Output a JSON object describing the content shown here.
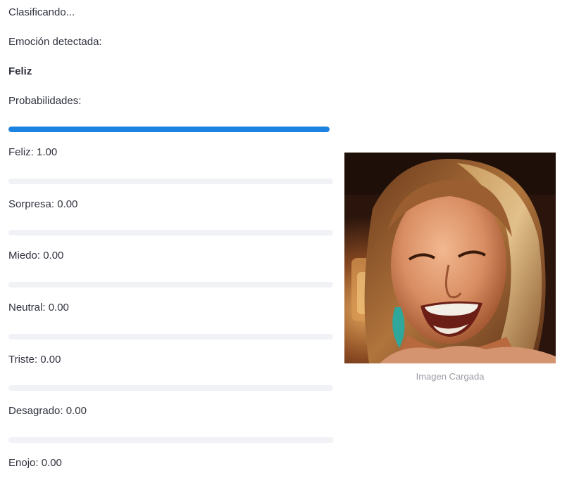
{
  "status": {
    "classifying": "Clasificando...",
    "emotion_label": "Emoción detectada:",
    "emotion_value": "Feliz",
    "probabilities_label": "Probabilidades:"
  },
  "probabilities": [
    {
      "label": "Feliz: 1.00",
      "value": 1.0
    },
    {
      "label": "Sorpresa: 0.00",
      "value": 0.0
    },
    {
      "label": "Miedo: 0.00",
      "value": 0.0
    },
    {
      "label": "Neutral: 0.00",
      "value": 0.0
    },
    {
      "label": "Triste: 0.00",
      "value": 0.0
    },
    {
      "label": "Desagrado: 0.00",
      "value": 0.0
    },
    {
      "label": "Enojo: 0.00",
      "value": 0.0
    }
  ],
  "image": {
    "caption": "Imagen Cargada"
  },
  "colors": {
    "bar_fill": "#1c83e1",
    "bar_track": "#f0f2f6",
    "text": "#31333f",
    "caption": "#9a9ba4"
  }
}
